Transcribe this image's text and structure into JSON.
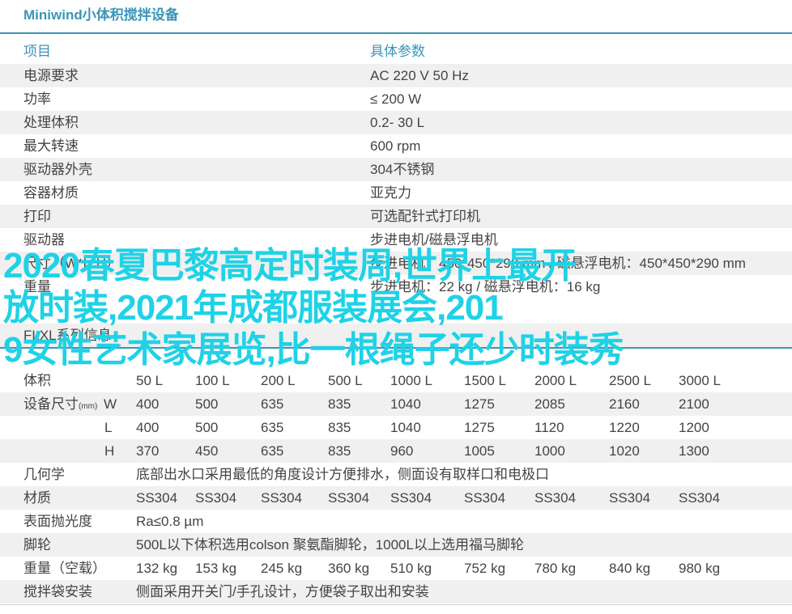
{
  "title": "Miniwind小体积搅拌设备",
  "spec_header": {
    "item": "项目",
    "param": "具体参数"
  },
  "spec_rows": [
    {
      "label": "电源要求",
      "value": "AC 220  V 50 Hz"
    },
    {
      "label": "功率",
      "value": "≤ 200 W"
    },
    {
      "label": "处理体积",
      "value": "0.2- 30 L"
    },
    {
      "label": "最大转速",
      "value": "600  rpm"
    },
    {
      "label": "驱动器外壳",
      "value": "304不锈钢"
    },
    {
      "label": "容器材质",
      "value": "亚克力"
    },
    {
      "label": "打印",
      "value": "可选配针式打印机"
    },
    {
      "label": "驱动器",
      "value": "步进电机/磁悬浮电机"
    },
    {
      "label": "尺寸（W*L*H）",
      "value": "步进电机：450*450*290 mm / 磁悬浮电机：450*450*290 mm"
    },
    {
      "label": "重量",
      "value": "步进电机：22 kg / 磁悬浮电机：16 kg"
    }
  ],
  "section_title": "FLXL系列信息",
  "flx_table": {
    "volume": {
      "label": "体积",
      "values": [
        "50 L",
        "100 L",
        "200 L",
        "500 L",
        "1000 L",
        "1500 L",
        "2000 L",
        "2500 L",
        "3000 L"
      ]
    },
    "dims": {
      "label": "设备尺寸",
      "unit": "(mm)",
      "rows": [
        {
          "axis": "W",
          "values": [
            "400",
            "500",
            "635",
            "835",
            "1040",
            "1275",
            "2085",
            "2160",
            "2100"
          ]
        },
        {
          "axis": "L",
          "values": [
            "400",
            "500",
            "635",
            "835",
            "1040",
            "1275",
            "1120",
            "1220",
            "1200"
          ]
        },
        {
          "axis": "H",
          "values": [
            "370",
            "450",
            "635",
            "835",
            "960",
            "1005",
            "1000",
            "1020",
            "1300"
          ]
        }
      ]
    },
    "geometry": {
      "label": "几何学",
      "value": "底部出水口采用最低的角度设计方便排水，侧面设有取样口和电极口"
    },
    "material": {
      "label": "材质",
      "values": [
        "SS304",
        "SS304",
        "SS304",
        "SS304",
        "SS304",
        "SS304",
        "SS304",
        "SS304",
        "SS304"
      ]
    },
    "polish": {
      "label": "表面抛光度",
      "value": "Ra≤0.8 µm"
    },
    "casters": {
      "label": "脚轮",
      "value": "500L以下体积选用colson 聚氨酯脚轮，1000L以上选用福马脚轮"
    },
    "weight": {
      "label": "重量（空载）",
      "values": [
        "132 kg",
        "153 kg",
        "245 kg",
        "360 kg",
        "510 kg",
        "752 kg",
        "780 kg",
        "840 kg",
        "980 kg"
      ]
    },
    "install": {
      "label": "搅拌袋安装",
      "value": "侧面采用开关门/手孔设计，方便袋子取出和安装"
    }
  },
  "overlay_lines": [
    "2020春夏巴黎高定时装周,世界上最开",
    "放时装,2021年成都服装展会,201",
    "9女性艺术家展览,比一根绳子还少时装秀"
  ],
  "colors": {
    "accent": "#3a95b8",
    "overlay": "#1fd2e6",
    "shade": "#f0f0f0"
  }
}
